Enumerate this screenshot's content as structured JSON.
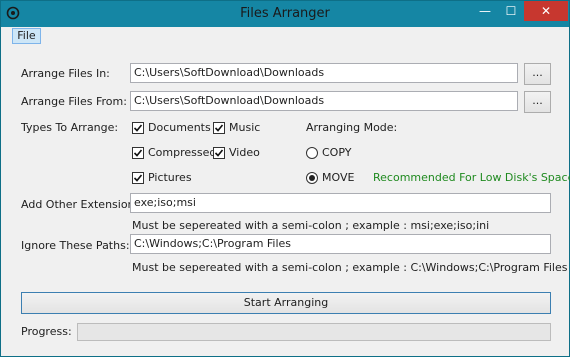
{
  "window": {
    "title": "Files Arranger",
    "icon": "app-icon",
    "controls": {
      "minimize": "—",
      "maximize": "☐",
      "close": "✕"
    }
  },
  "menu": {
    "file": "File"
  },
  "arrange_in": {
    "label": "Arrange Files In:",
    "value": "C:\\Users\\SoftDownload\\Downloads",
    "browse": "..."
  },
  "arrange_from": {
    "label": "Arrange Files From:",
    "value": "C:\\Users\\SoftDownload\\Downloads",
    "browse": "..."
  },
  "types": {
    "label": "Types To Arrange:",
    "items": [
      {
        "label": "Documents",
        "checked": true
      },
      {
        "label": "Music",
        "checked": true
      },
      {
        "label": "Compressed",
        "checked": true
      },
      {
        "label": "Video",
        "checked": true
      },
      {
        "label": "Pictures",
        "checked": true
      }
    ]
  },
  "mode": {
    "label": "Arranging Mode:",
    "options": [
      {
        "label": "COPY",
        "selected": false
      },
      {
        "label": "MOVE",
        "selected": true
      }
    ],
    "recommendation": "Recommended For Low Disk's Space"
  },
  "extensions": {
    "label": "Add Other Extensions:",
    "value": "exe;iso;msi",
    "hint": "Must be sepereated with a semi-colon ; example : msi;exe;iso;ini"
  },
  "ignore": {
    "label": "Ignore These Paths:",
    "value": "C:\\Windows;C:\\Program Files",
    "hint": "Must be sepereated with a semi-colon ; example : C:\\Windows;C:\\Program Files"
  },
  "start_button": "Start Arranging",
  "progress": {
    "label": "Progress:",
    "value": 0
  }
}
